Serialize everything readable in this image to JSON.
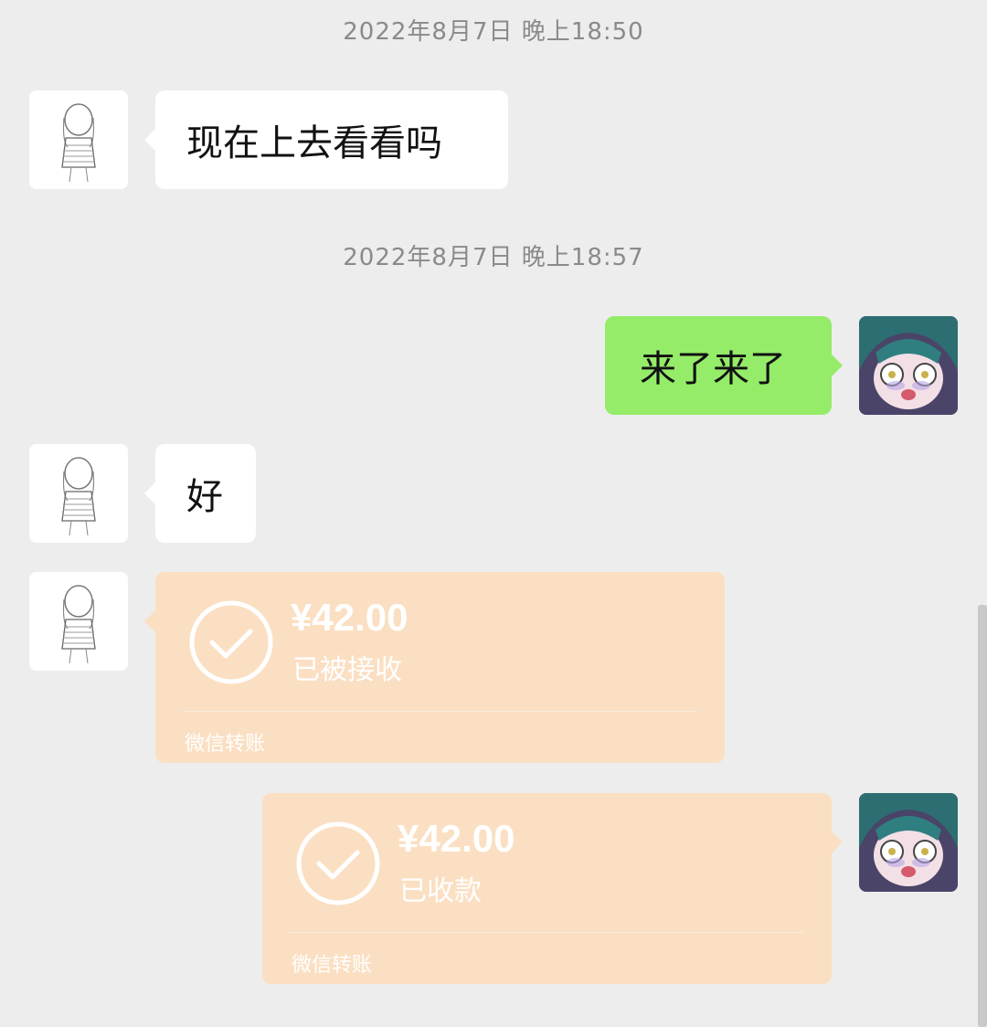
{
  "timestamps": [
    "2022年8月7日 晚上18:50",
    "2022年8月7日 晚上18:57"
  ],
  "messages": [
    {
      "side": "left",
      "text": "现在上去看看吗"
    },
    {
      "side": "right",
      "text": "来了来了"
    },
    {
      "side": "left",
      "text": "好"
    }
  ],
  "transfers": [
    {
      "side": "left",
      "amount": "¥42.00",
      "status": "已被接收",
      "label": "微信转账"
    },
    {
      "side": "right",
      "amount": "¥42.00",
      "status": "已收款",
      "label": "微信转账"
    }
  ],
  "colors": {
    "background": "#ededed",
    "bubble_self": "#95ec69",
    "bubble_other": "#ffffff",
    "transfer_done": "#fbdfc2"
  },
  "icons": {
    "transfer_check": "check-circle-icon",
    "avatar_other": "girl-sketch-avatar",
    "avatar_self": "anime-boy-avatar"
  }
}
